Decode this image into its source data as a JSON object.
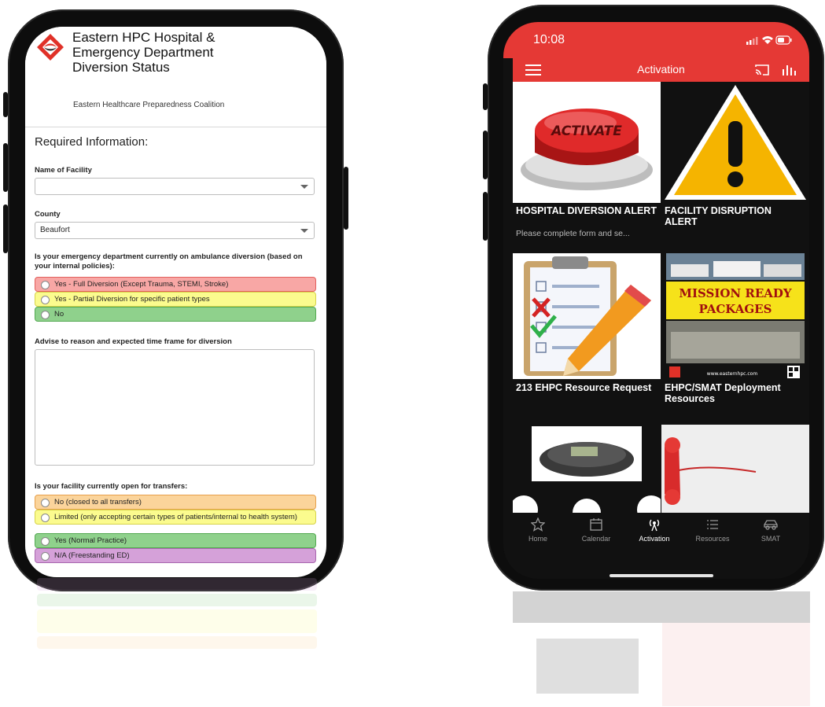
{
  "left_phone": {
    "form": {
      "title": "Eastern HPC Hospital & Emergency Department Diversion Status",
      "subtitle": "Eastern Healthcare Preparedness Coalition",
      "section_heading": "Required Information:",
      "facility_label": "Name of Facility",
      "facility_value": "",
      "county_label": "County",
      "county_value": "Beaufort",
      "diversion_question": "Is your emergency department currently on ambulance diversion (based on your internal policies):",
      "diversion_options": [
        {
          "label": "Yes - Full Diversion (Except Trauma, STEMI, Stroke)",
          "bg": "#f8a7a5",
          "border": "#e25f5c"
        },
        {
          "label": "Yes - Partial Diversion for specific patient types",
          "bg": "#fbfb8e",
          "border": "#d7d34a"
        },
        {
          "label": "No",
          "bg": "#8fd18c",
          "border": "#53a951"
        }
      ],
      "reason_label": "Advise to reason and expected time frame for diversion",
      "reason_value": "",
      "transfers_question": "Is your facility currently open for transfers:",
      "transfer_options": [
        {
          "label": "No (closed to all transfers)",
          "bg": "#fbd49b",
          "border": "#e7a04c"
        },
        {
          "label": "Limited (only accepting certain types of patients/internal to health system)",
          "bg": "#fbfb8e",
          "border": "#d7d34a"
        },
        {
          "label": "Yes (Normal Practice)",
          "bg": "#8fd18c",
          "border": "#53a951"
        },
        {
          "label": "N/A (Freestanding ED)",
          "bg": "#d5a1d9",
          "border": "#a866ae"
        }
      ]
    }
  },
  "right_phone": {
    "status_time": "10:08",
    "app_title": "Activation",
    "accent_color": "#e53935",
    "tiles": [
      {
        "title": "HOSPITAL DIVERSION ALERT",
        "subtitle": "Please complete form and se...",
        "image": "activate-button-icon",
        "image_text": "ACTIVATE"
      },
      {
        "title": "FACILITY DISRUPTION ALERT",
        "image": "warning-sign-icon"
      },
      {
        "title": "213 EHPC Resource Request",
        "image": "checklist-clipboard-icon"
      },
      {
        "title": "EHPC/SMAT Deployment Resources",
        "image": "mission-ready-packages-image",
        "image_text": "MISSION READY PACKAGES",
        "image_footer": "www.easternhpc.com"
      },
      {
        "title": "",
        "image": "conference-phone-icon"
      },
      {
        "title": "",
        "image": "red-telephone-icon"
      }
    ],
    "tabs": [
      {
        "label": "Home",
        "icon": "star-icon",
        "active": false
      },
      {
        "label": "Calendar",
        "icon": "calendar-icon",
        "active": false
      },
      {
        "label": "Activation",
        "icon": "broadcast-icon",
        "active": true
      },
      {
        "label": "Resources",
        "icon": "list-icon",
        "active": false
      },
      {
        "label": "SMAT",
        "icon": "car-icon",
        "active": false
      }
    ]
  }
}
